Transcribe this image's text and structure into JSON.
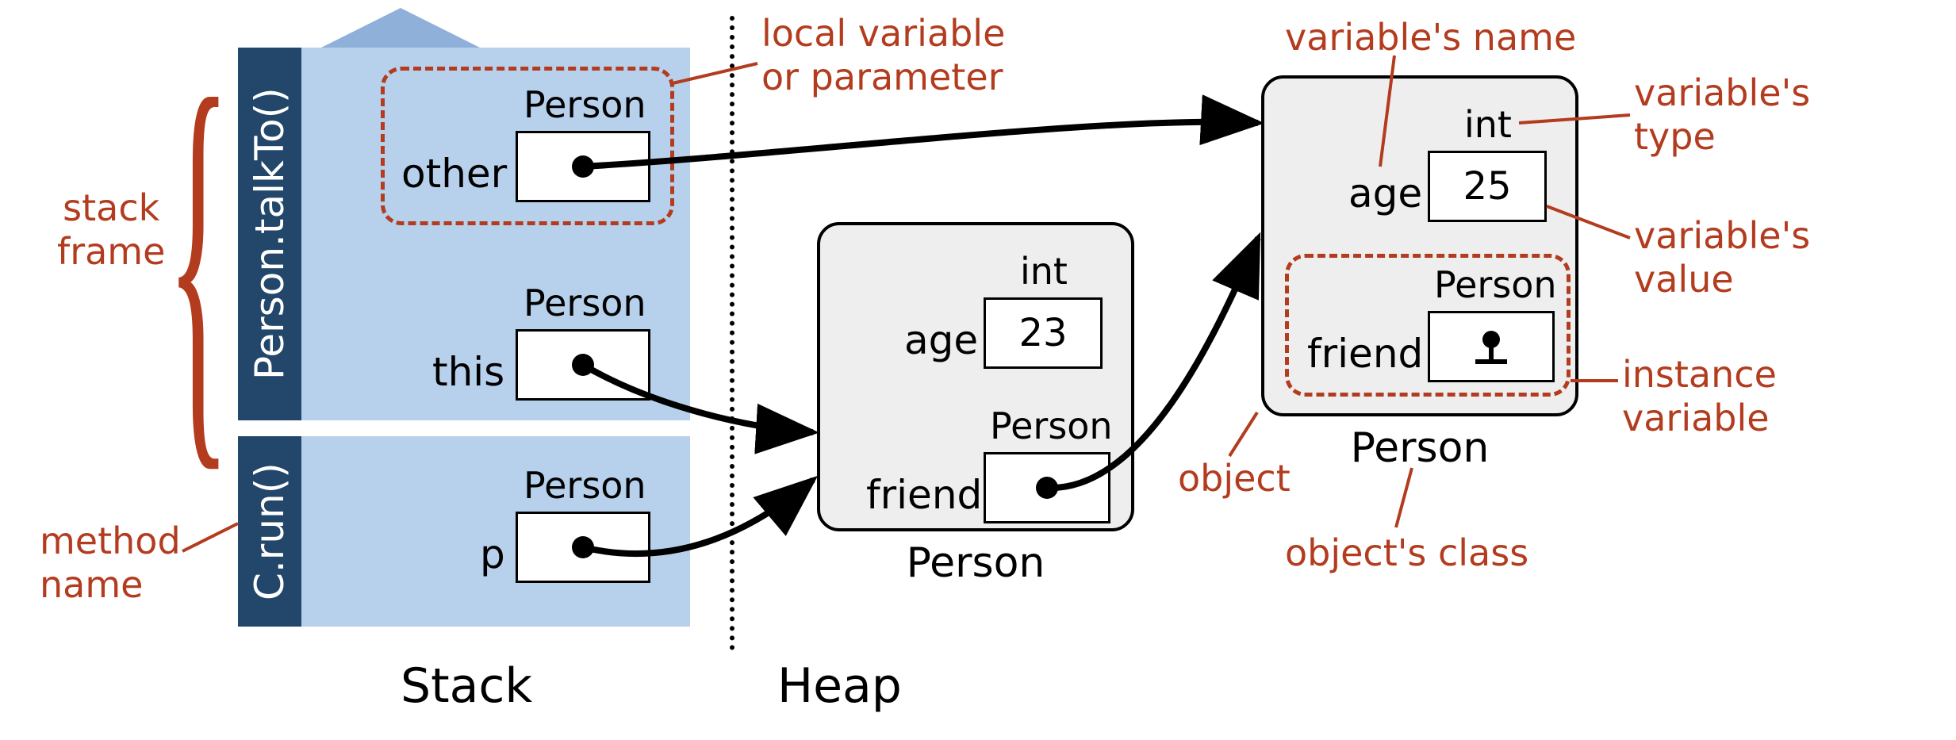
{
  "regions": {
    "stack": "Stack",
    "heap": "Heap"
  },
  "annotations": {
    "stack_frame": "stack\nframe",
    "method_name": "method\nname",
    "local_var": "local variable\nor parameter",
    "var_name": "variable's name",
    "var_type": "variable's\ntype",
    "var_value": "variable's\nvalue",
    "instance_var": "instance\nvariable",
    "object": "object",
    "object_class": "object's class"
  },
  "stack": {
    "frames": [
      {
        "method": "Person.talkTo()",
        "vars": [
          {
            "name": "other",
            "type": "Person",
            "value_kind": "ref"
          },
          {
            "name": "this",
            "type": "Person",
            "value_kind": "ref"
          }
        ]
      },
      {
        "method": "C.run()",
        "vars": [
          {
            "name": "p",
            "type": "Person",
            "value_kind": "ref"
          }
        ]
      }
    ]
  },
  "heap": {
    "objects": [
      {
        "class": "Person",
        "fields": [
          {
            "name": "age",
            "type": "int",
            "value": "23",
            "value_kind": "int"
          },
          {
            "name": "friend",
            "type": "Person",
            "value_kind": "ref"
          }
        ]
      },
      {
        "class": "Person",
        "fields": [
          {
            "name": "age",
            "type": "int",
            "value": "25",
            "value_kind": "int"
          },
          {
            "name": "friend",
            "type": "Person",
            "value_kind": "null"
          }
        ]
      }
    ]
  }
}
